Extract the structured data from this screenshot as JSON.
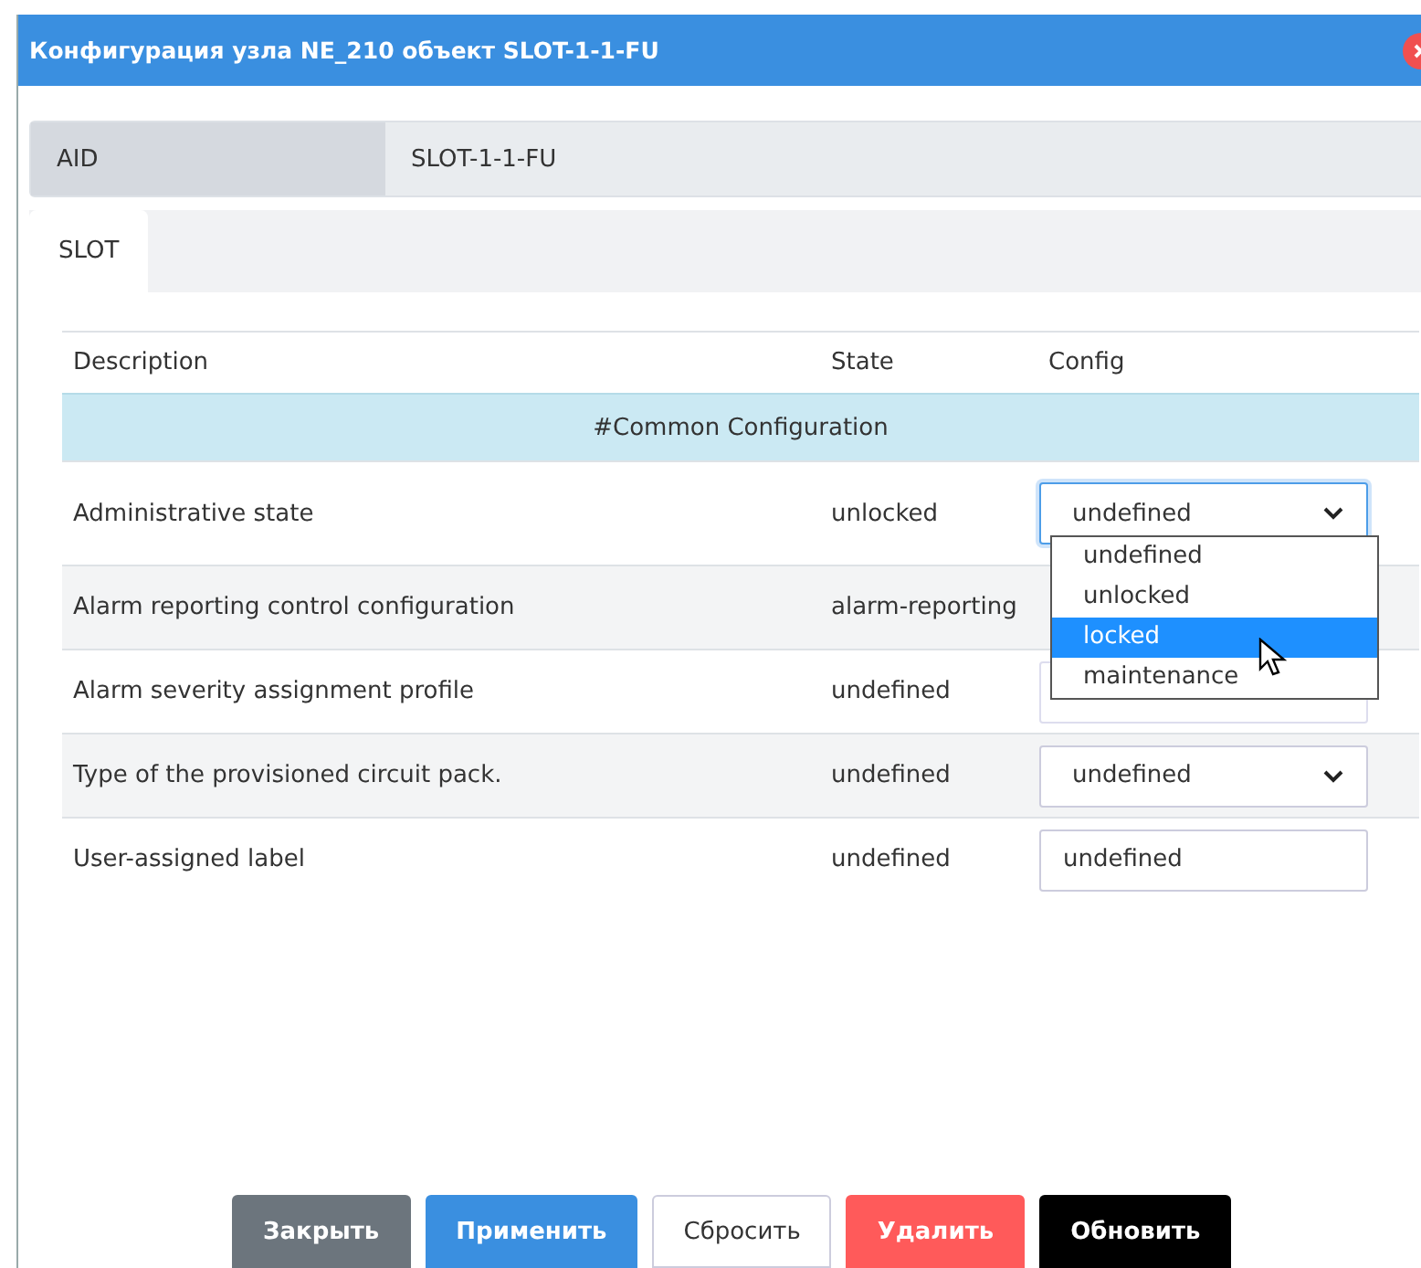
{
  "window": {
    "title": "Конфигурация узла NE_210 объект SLOT-1-1-FU"
  },
  "aid": {
    "label": "AID",
    "value": "SLOT-1-1-FU"
  },
  "tabs": [
    {
      "label": "SLOT",
      "selected": true
    }
  ],
  "table": {
    "columns": [
      "Description",
      "State",
      "Config"
    ],
    "group": "#Common Configuration",
    "rows": [
      {
        "description": "Administrative state",
        "state": "unlocked",
        "config": {
          "kind": "select",
          "value": "undefined",
          "focused": true
        }
      },
      {
        "description": "Alarm reporting control configuration",
        "state": "alarm-reporting",
        "config": {
          "kind": "hidden"
        }
      },
      {
        "description": "Alarm severity assignment profile",
        "state": "undefined",
        "config": {
          "kind": "covered"
        }
      },
      {
        "description": "Type of the provisioned circuit pack.",
        "state": "undefined",
        "config": {
          "kind": "select",
          "value": "undefined",
          "focused": false
        }
      },
      {
        "description": "User-assigned label",
        "state": "undefined",
        "config": {
          "kind": "input",
          "value": "undefined"
        }
      }
    ]
  },
  "dropdown": {
    "options": [
      {
        "label": "undefined",
        "selected": false
      },
      {
        "label": "unlocked",
        "selected": false
      },
      {
        "label": "locked",
        "selected": true
      },
      {
        "label": "maintenance",
        "selected": false
      }
    ]
  },
  "buttons": [
    {
      "label": "Закрыть",
      "kind": "secondary"
    },
    {
      "label": "Применить",
      "kind": "primary"
    },
    {
      "label": "Сбросить",
      "kind": "light"
    },
    {
      "label": "Удалить",
      "kind": "danger"
    },
    {
      "label": "Обновить",
      "kind": "dark"
    }
  ]
}
